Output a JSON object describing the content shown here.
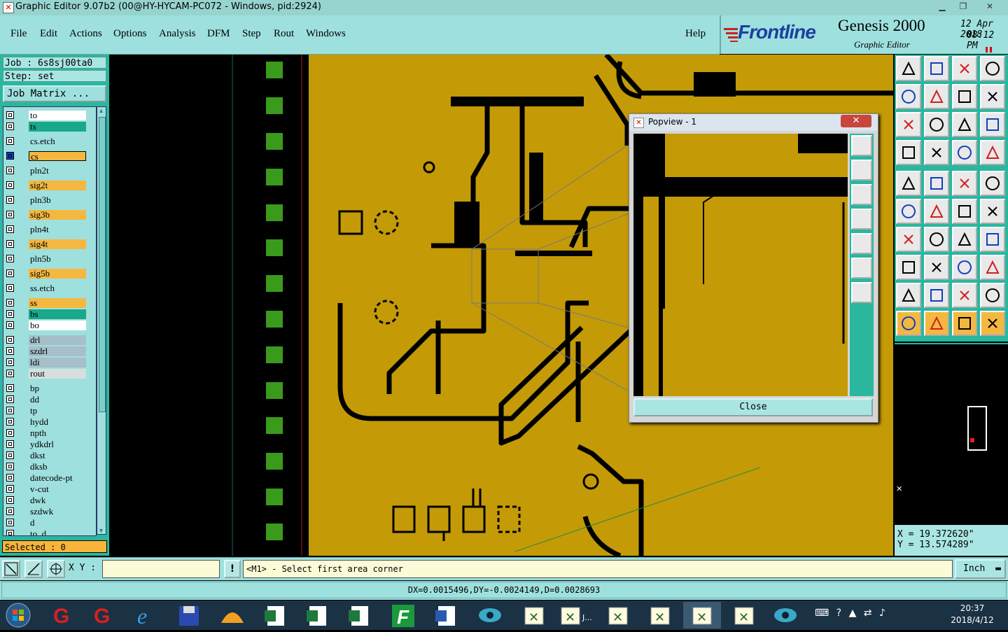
{
  "window": {
    "title": "Graphic Editor 9.07b2 (00@HY-HYCAM-PC072 - Windows, pid:2924)"
  },
  "menu": {
    "items": [
      "File",
      "Edit",
      "Actions",
      "Options",
      "Analysis",
      "DFM",
      "Step",
      "Rout",
      "Windows"
    ],
    "help": "Help"
  },
  "brand": {
    "logo": "Frontline",
    "product": "Genesis 2000",
    "subtitle": "Graphic Editor",
    "date": "12 Apr 2018",
    "time": "08:12 PM"
  },
  "job": {
    "job_label": "Job : 6s8sj00ta0",
    "step_label": "Step: set",
    "job_matrix": "Job Matrix ..."
  },
  "layers": [
    {
      "name": "to",
      "color": "#ffffff"
    },
    {
      "name": "ts",
      "color": "#1aa88a"
    },
    {
      "name": "cs.etch",
      "color": "#9ee0de"
    },
    {
      "name": "cs",
      "color": "#f4b840",
      "active": true
    },
    {
      "name": "pln2t",
      "color": "#9ee0de"
    },
    {
      "name": "sig2t",
      "color": "#f4b840"
    },
    {
      "name": "pln3b",
      "color": "#9ee0de"
    },
    {
      "name": "sig3b",
      "color": "#f4b840"
    },
    {
      "name": "pln4t",
      "color": "#9ee0de"
    },
    {
      "name": "sig4t",
      "color": "#f4b840"
    },
    {
      "name": "pln5b",
      "color": "#9ee0de"
    },
    {
      "name": "sig5b",
      "color": "#f4b840"
    },
    {
      "name": "ss.etch",
      "color": "#9ee0de"
    },
    {
      "name": "ss",
      "color": "#f4b840"
    },
    {
      "name": "bs",
      "color": "#1aa88a"
    },
    {
      "name": "bo",
      "color": "#ffffff"
    },
    {
      "name": "drl",
      "color": "#a6bfc8"
    },
    {
      "name": "szdrl",
      "color": "#a6bfc8"
    },
    {
      "name": "ldi",
      "color": "#a6bfc8"
    },
    {
      "name": "rout",
      "color": "#d8dede"
    },
    {
      "name": "bp",
      "color": "#9ee0de"
    },
    {
      "name": "dd",
      "color": "#9ee0de"
    },
    {
      "name": "tp",
      "color": "#9ee0de"
    },
    {
      "name": "hydd",
      "color": "#9ee0de"
    },
    {
      "name": "npth",
      "color": "#9ee0de"
    },
    {
      "name": "ydkdrl",
      "color": "#9ee0de"
    },
    {
      "name": "dkst",
      "color": "#9ee0de"
    },
    {
      "name": "dksb",
      "color": "#9ee0de"
    },
    {
      "name": "datecode-pt",
      "color": "#9ee0de"
    },
    {
      "name": "v-cut",
      "color": "#9ee0de"
    },
    {
      "name": "dwk",
      "color": "#9ee0de"
    },
    {
      "name": "szdwk",
      "color": "#9ee0de"
    },
    {
      "name": "d",
      "color": "#9ee0de"
    },
    {
      "name": "to_d",
      "color": "#9ee0de"
    }
  ],
  "selected": "Selected : 0",
  "popview": {
    "title": "Popview - 1",
    "close_label": "Close"
  },
  "coords": {
    "x": "X = 19.372620\"",
    "y": "Y = 13.574289\""
  },
  "command": {
    "xy_label": "X Y :",
    "xy_value": "",
    "prompt": "<M1> - Select first area corner",
    "units": "Inch"
  },
  "status": "DX=0.0015496,DY=-0.0024149,D=0.0028693",
  "taskbar": {
    "time": "20:37",
    "date": "2018/4/12"
  },
  "colors": {
    "copper": "#c49a06",
    "panel": "#2ab79e",
    "menu": "#9ee0de",
    "pad": "#3a9a1c"
  }
}
